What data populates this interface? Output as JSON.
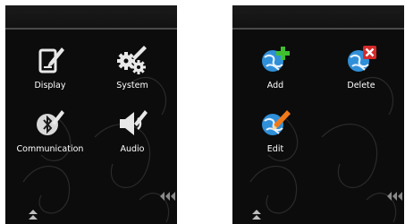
{
  "settings_menu": {
    "items": [
      {
        "label": "Display",
        "icon": "display-settings-icon"
      },
      {
        "label": "System",
        "icon": "system-gears-icon"
      },
      {
        "label": "Communication",
        "icon": "bluetooth-communication-icon"
      },
      {
        "label": "Audio",
        "icon": "audio-speaker-icon"
      }
    ]
  },
  "profile_menu": {
    "items": [
      {
        "label": "Add",
        "icon": "globe-add-icon"
      },
      {
        "label": "Delete",
        "icon": "globe-delete-icon"
      },
      {
        "label": "Edit",
        "icon": "globe-edit-icon"
      }
    ]
  },
  "colors": {
    "background": "#0c0c0c",
    "label": "#ffffff",
    "add_green": "#3fbf2f",
    "delete_red": "#d62a2a",
    "edit_orange": "#f07a1a",
    "globe_blue": "#2f8fd8"
  }
}
